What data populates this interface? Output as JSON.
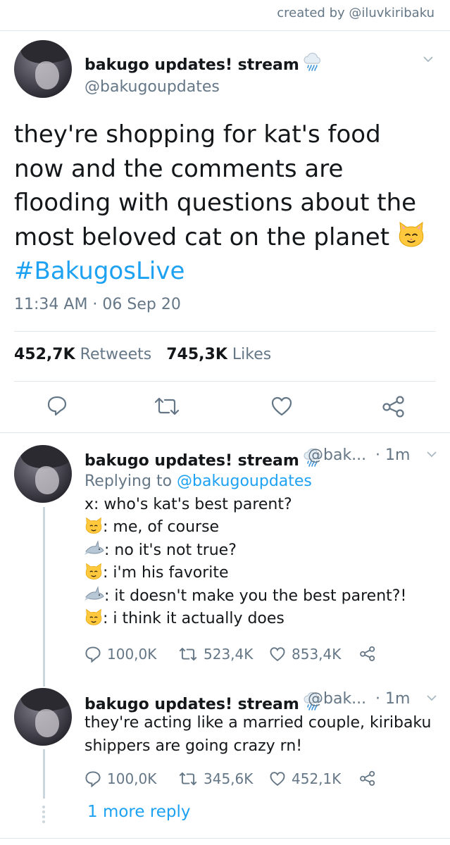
{
  "credit": "created by @iluvkiribaku",
  "tweet": {
    "author_name": "bakugo updates! stream",
    "author_handle": "@bakugoupdates",
    "text_lines": [
      "they're shopping for kat's food",
      "now and the comments are",
      "flooding with questions about the",
      "most beloved cat on the planet"
    ],
    "hashtag": "#BakugosLive",
    "timestamp": "11:34 AM · 06 Sep 20",
    "retweet_count": "452,7K",
    "retweets_label": "Retweets",
    "like_count": "745,3K",
    "likes_label": "Likes"
  },
  "replies": [
    {
      "author_name": "bakugo updates! stream",
      "author_handle": "@bak...",
      "time": "· 1m",
      "replying_prefix": "Replying to",
      "replying_to": "@bakugoupdates",
      "lines": [
        {
          "emoji": "",
          "text": "x: who's kat's best parent?"
        },
        {
          "emoji": "cat-face",
          "text": ": me, of course"
        },
        {
          "emoji": "shark",
          "text": ": no it's not true?"
        },
        {
          "emoji": "cat-face",
          "text": ": i'm his favorite"
        },
        {
          "emoji": "shark",
          "text": ": it doesn't make you the best parent?!"
        },
        {
          "emoji": "cat-face",
          "text": ": i think it actually does"
        }
      ],
      "reply_count": "100,0K",
      "retweet_count": "523,4K",
      "like_count": "853,4K"
    },
    {
      "author_name": "bakugo updates! stream",
      "author_handle": "@bak...",
      "time": "· 1m",
      "lines": [
        {
          "emoji": "",
          "text": "they're acting like a married couple, kiribaku"
        },
        {
          "emoji": "",
          "text": "shippers are going crazy rn!"
        }
      ],
      "reply_count": "100,0K",
      "retweet_count": "345,6K",
      "like_count": "452,1K"
    }
  ],
  "more_replies": "1 more reply",
  "colors": {
    "accent": "#1da1f2",
    "secondary_text": "#657786",
    "primary_text": "#14171a",
    "divider": "#e1e8ed"
  }
}
